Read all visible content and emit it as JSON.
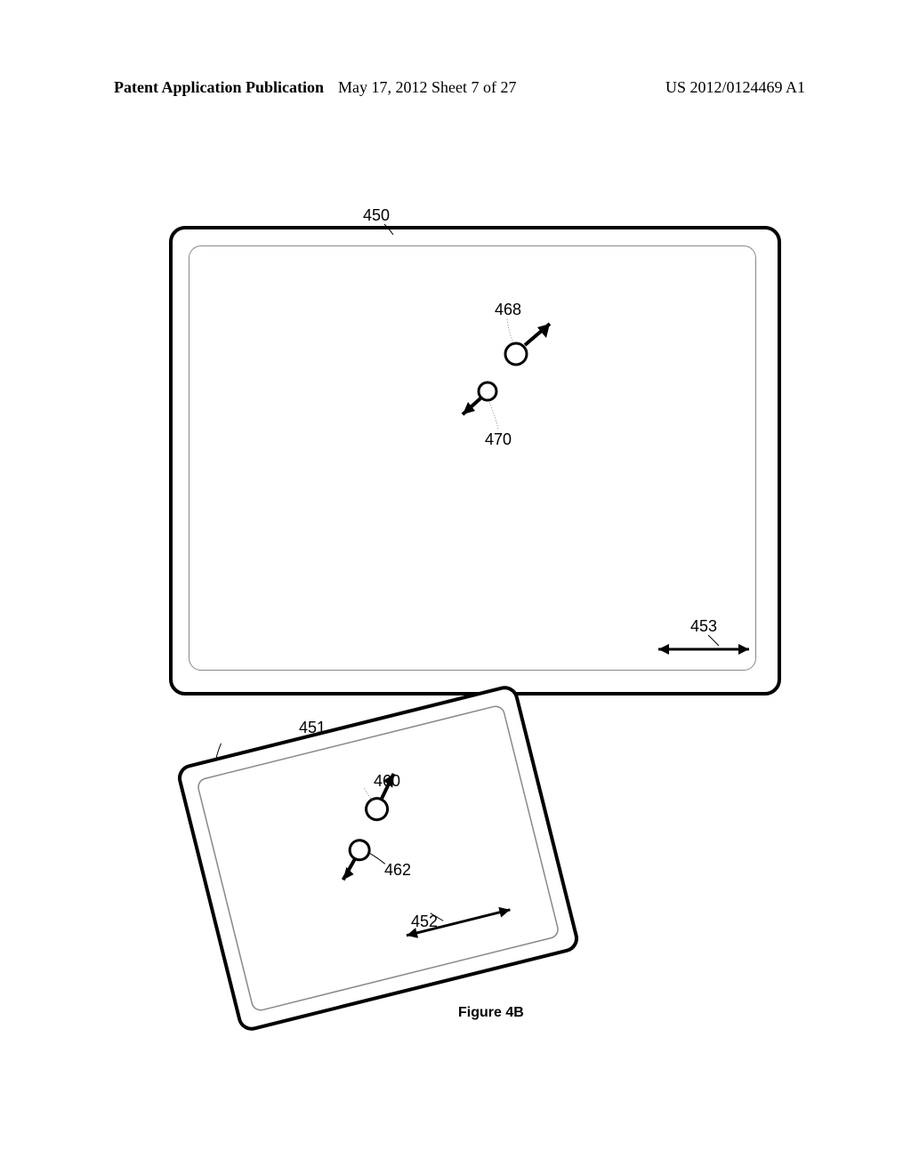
{
  "header": {
    "left": "Patent Application Publication",
    "center": "May 17, 2012  Sheet 7 of 27",
    "right": "US 2012/0124469 A1"
  },
  "labels": {
    "l450": "450",
    "l468": "468",
    "l470": "470",
    "l453": "453",
    "l451": "451",
    "l460": "460",
    "l462": "462",
    "l452": "452"
  },
  "caption": "Figure 4B"
}
